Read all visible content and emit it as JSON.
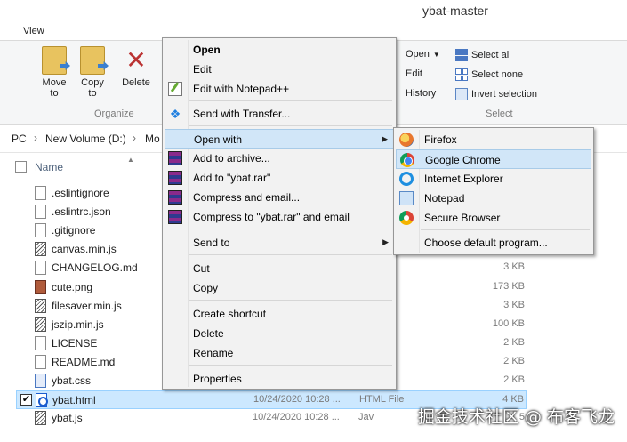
{
  "window": {
    "title": "ybat-master"
  },
  "tabs": {
    "view": "View"
  },
  "ribbon": {
    "move_to": "Move to",
    "copy_to": "Copy to",
    "delete": "Delete",
    "organize": "Organize",
    "open": "Open",
    "edit": "Edit",
    "history": "History",
    "select_all": "Select all",
    "select_none": "Select none",
    "invert_selection": "Invert selection",
    "select": "Select"
  },
  "breadcrumb": {
    "pc": "PC",
    "drive": "New Volume (D:)",
    "folder": "Mo"
  },
  "columns": {
    "name": "Name"
  },
  "files": [
    {
      "name": ".eslintignore",
      "date": "",
      "type": "",
      "size": "",
      "icon": "file-icon"
    },
    {
      "name": ".eslintrc.json",
      "date": "",
      "type": "",
      "size": "",
      "icon": "json-file-icon"
    },
    {
      "name": ".gitignore",
      "date": "",
      "type": "",
      "size": "",
      "icon": "file-icon"
    },
    {
      "name": "canvas.min.js",
      "date": "",
      "type": "",
      "size": "",
      "icon": "js-file-icon"
    },
    {
      "name": "CHANGELOG.md",
      "date": "",
      "type": "",
      "size": "3 KB",
      "icon": "file-icon"
    },
    {
      "name": "cute.png",
      "date": "",
      "type": "",
      "size": "173 KB",
      "icon": "image-file-icon"
    },
    {
      "name": "filesaver.min.js",
      "date": "",
      "type": "",
      "size": "3 KB",
      "icon": "js-file-icon"
    },
    {
      "name": "jszip.min.js",
      "date": "",
      "type": "",
      "size": "100 KB",
      "icon": "js-file-icon"
    },
    {
      "name": "LICENSE",
      "date": "",
      "type": "",
      "size": "2 KB",
      "icon": "file-icon"
    },
    {
      "name": "README.md",
      "date": "",
      "type": "",
      "size": "2 KB",
      "icon": "file-icon"
    },
    {
      "name": "ybat.css",
      "date": "",
      "type": "",
      "size": "2 KB",
      "icon": "css-file-icon"
    },
    {
      "name": "ybat.html",
      "date": "10/24/2020 10:28 ...",
      "type": "HTML File",
      "size": "4 KB",
      "icon": "html-file-icon",
      "selected": true
    },
    {
      "name": "ybat.js",
      "date": "10/24/2020 10:28 ...",
      "type": "Jav",
      "size": "5",
      "icon": "js-file-icon"
    }
  ],
  "context_menu": {
    "open": "Open",
    "edit": "Edit",
    "edit_npp": "Edit with Notepad++",
    "send_transfer": "Send with Transfer...",
    "open_with": "Open with",
    "add_archive": "Add to archive...",
    "add_rar": "Add to \"ybat.rar\"",
    "compress_email": "Compress and email...",
    "compress_rar_email": "Compress to \"ybat.rar\" and email",
    "send_to": "Send to",
    "cut": "Cut",
    "copy": "Copy",
    "create_shortcut": "Create shortcut",
    "delete": "Delete",
    "rename": "Rename",
    "properties": "Properties"
  },
  "open_with_menu": {
    "firefox": "Firefox",
    "chrome": "Google Chrome",
    "ie": "Internet Explorer",
    "notepad": "Notepad",
    "secure_browser": "Secure Browser",
    "choose_default": "Choose default program..."
  },
  "watermark": "掘金技术社区 @ 布客飞龙"
}
